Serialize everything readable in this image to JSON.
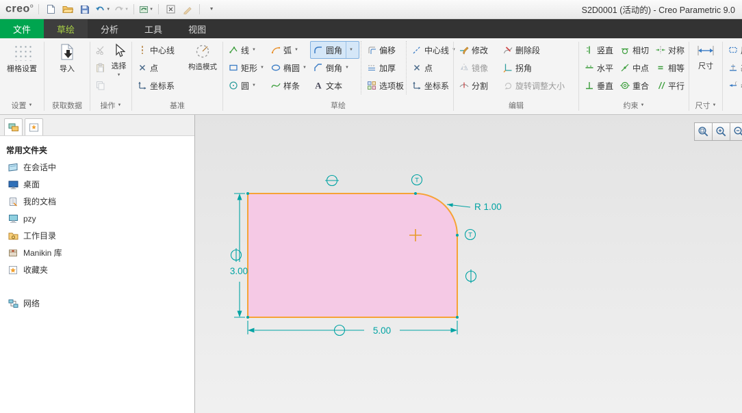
{
  "titlebar": {
    "logo": "creo",
    "title": "S2D0001 (活动的) - Creo Parametric 9.0",
    "icons": [
      "new-file-icon",
      "open-icon",
      "save-icon",
      "undo-icon",
      "redo-icon",
      "regenerate-icon",
      "close-window-icon",
      "model-display-icon",
      "toolbar-options-icon"
    ]
  },
  "tabs": [
    "文件",
    "草绘",
    "分析",
    "工具",
    "视图"
  ],
  "ribbon": {
    "settings": {
      "group_label": "设置",
      "grid_settings": "栅格设置"
    },
    "get_data": {
      "group_label": "获取数据",
      "import": "导入"
    },
    "operations": {
      "group_label": "操作",
      "select": "选择"
    },
    "datum": {
      "group_label": "基准",
      "centerline": "中心线",
      "point": "点",
      "csys": "坐标系",
      "construction_mode": "构造模式"
    },
    "sketch": {
      "group_label": "草绘",
      "line": "线",
      "arc": "弧",
      "fillet": "圆角",
      "rectangle": "矩形",
      "ellipse": "椭圆",
      "chamfer": "倒角",
      "circle": "圆",
      "spline": "样条",
      "text": "文本",
      "offset": "偏移",
      "thicken": "加厚",
      "palette": "选项板",
      "centerline2": "中心线",
      "point2": "点",
      "csys2": "坐标系"
    },
    "edit": {
      "group_label": "编辑",
      "modify": "修改",
      "delete_segment": "删除段",
      "mirror": "镜像",
      "corner": "拐角",
      "divide": "分割",
      "rotate_resize": "旋转调整大小"
    },
    "constrain": {
      "group_label": "约束",
      "vertical": "竖直",
      "tangent": "相切",
      "symmetric": "对称",
      "horizontal": "水平",
      "midpoint": "中点",
      "equal": "相等",
      "perpendicular": "垂直",
      "coincident": "重合",
      "parallel": "平行"
    },
    "dimension": {
      "group_label": "尺寸",
      "dimension": "尺寸",
      "perimeter": "周",
      "baseline": "基",
      "reference": "参"
    }
  },
  "sidebar": {
    "header": "常用文件夹",
    "items": [
      {
        "label": "在会话中",
        "icon": "session-icon"
      },
      {
        "label": "桌面",
        "icon": "desktop-icon"
      },
      {
        "label": "我的文档",
        "icon": "documents-icon"
      },
      {
        "label": "pzy",
        "icon": "computer-icon"
      },
      {
        "label": "工作目录",
        "icon": "working-directory-icon"
      },
      {
        "label": "Manikin 库",
        "icon": "library-icon"
      },
      {
        "label": "收藏夹",
        "icon": "favorites-icon"
      }
    ],
    "network": {
      "label": "网络",
      "icon": "network-icon"
    }
  },
  "canvas": {
    "height_dim": "3.00",
    "width_dim": "5.00",
    "radius_dim": "R 1.00",
    "tangent_symbol": "T",
    "zoom_icons": [
      "zoom-box-icon",
      "zoom-in-icon",
      "zoom-out-icon"
    ]
  },
  "colors": {
    "brand_green": "#00a54f",
    "active_tab_text": "#a8cf45",
    "selected_tool_bg": "#d5e7f8",
    "selected_tool_border": "#7fb0e0",
    "sketch_annotation": "#00a3a3",
    "sketch_outline": "#f6a335",
    "sketch_fill": "#f5c9e5"
  }
}
